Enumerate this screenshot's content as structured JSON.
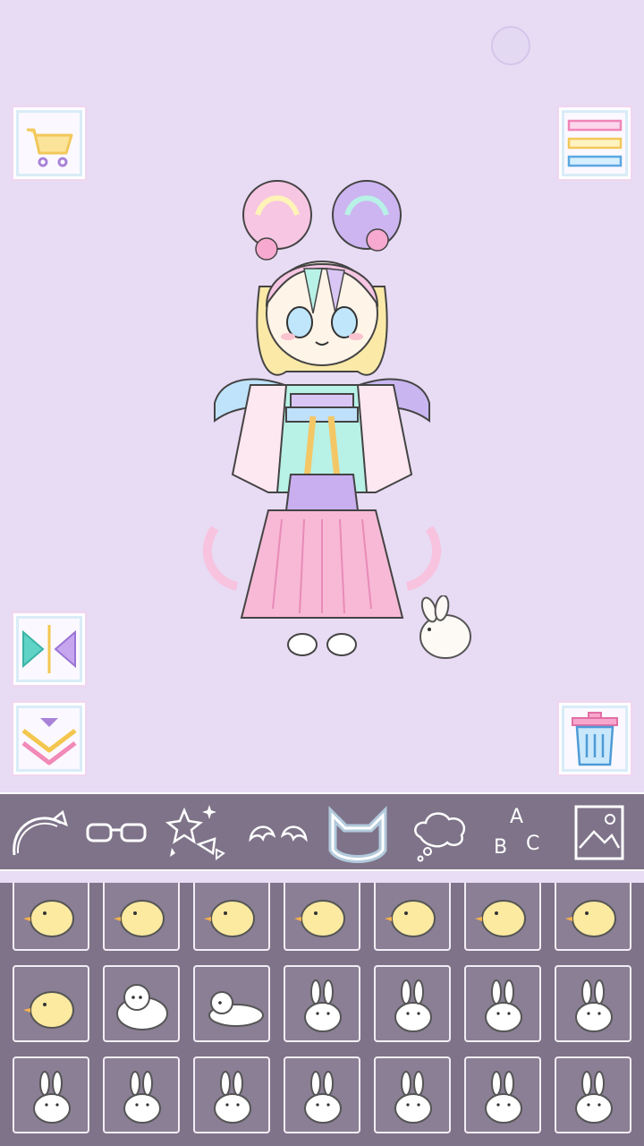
{
  "toolbar": {
    "cart": "cart-icon",
    "menu": "menu-icon",
    "flip": "flip-icon",
    "layer": "layer-down-icon",
    "trash": "trash-icon"
  },
  "categories": [
    {
      "id": "headband",
      "icon": "headband-icon"
    },
    {
      "id": "glasses",
      "icon": "glasses-icon"
    },
    {
      "id": "effects",
      "icon": "sparkles-icon"
    },
    {
      "id": "ears",
      "icon": "wings-icon"
    },
    {
      "id": "pets",
      "icon": "cat-ears-icon",
      "selected": true
    },
    {
      "id": "speech",
      "icon": "thought-bubble-icon"
    },
    {
      "id": "text",
      "icon": "abc-icon",
      "label_a": "A",
      "label_b": "B",
      "label_c": "C"
    },
    {
      "id": "background",
      "icon": "picture-icon"
    }
  ],
  "items": [
    "chick",
    "chick",
    "chick",
    "chick",
    "chick",
    "chick",
    "chick",
    "chick",
    "puppy",
    "puppy-lying",
    "bunny",
    "bunny",
    "bunny",
    "bunny",
    "bunny",
    "bunny",
    "bunny",
    "bunny",
    "bunny",
    "bunny",
    "bunny"
  ],
  "colors": {
    "stage_bg": "#e8dbf4",
    "bar_bg": "#7e7389",
    "selected_glow": "#c9f0ff"
  }
}
